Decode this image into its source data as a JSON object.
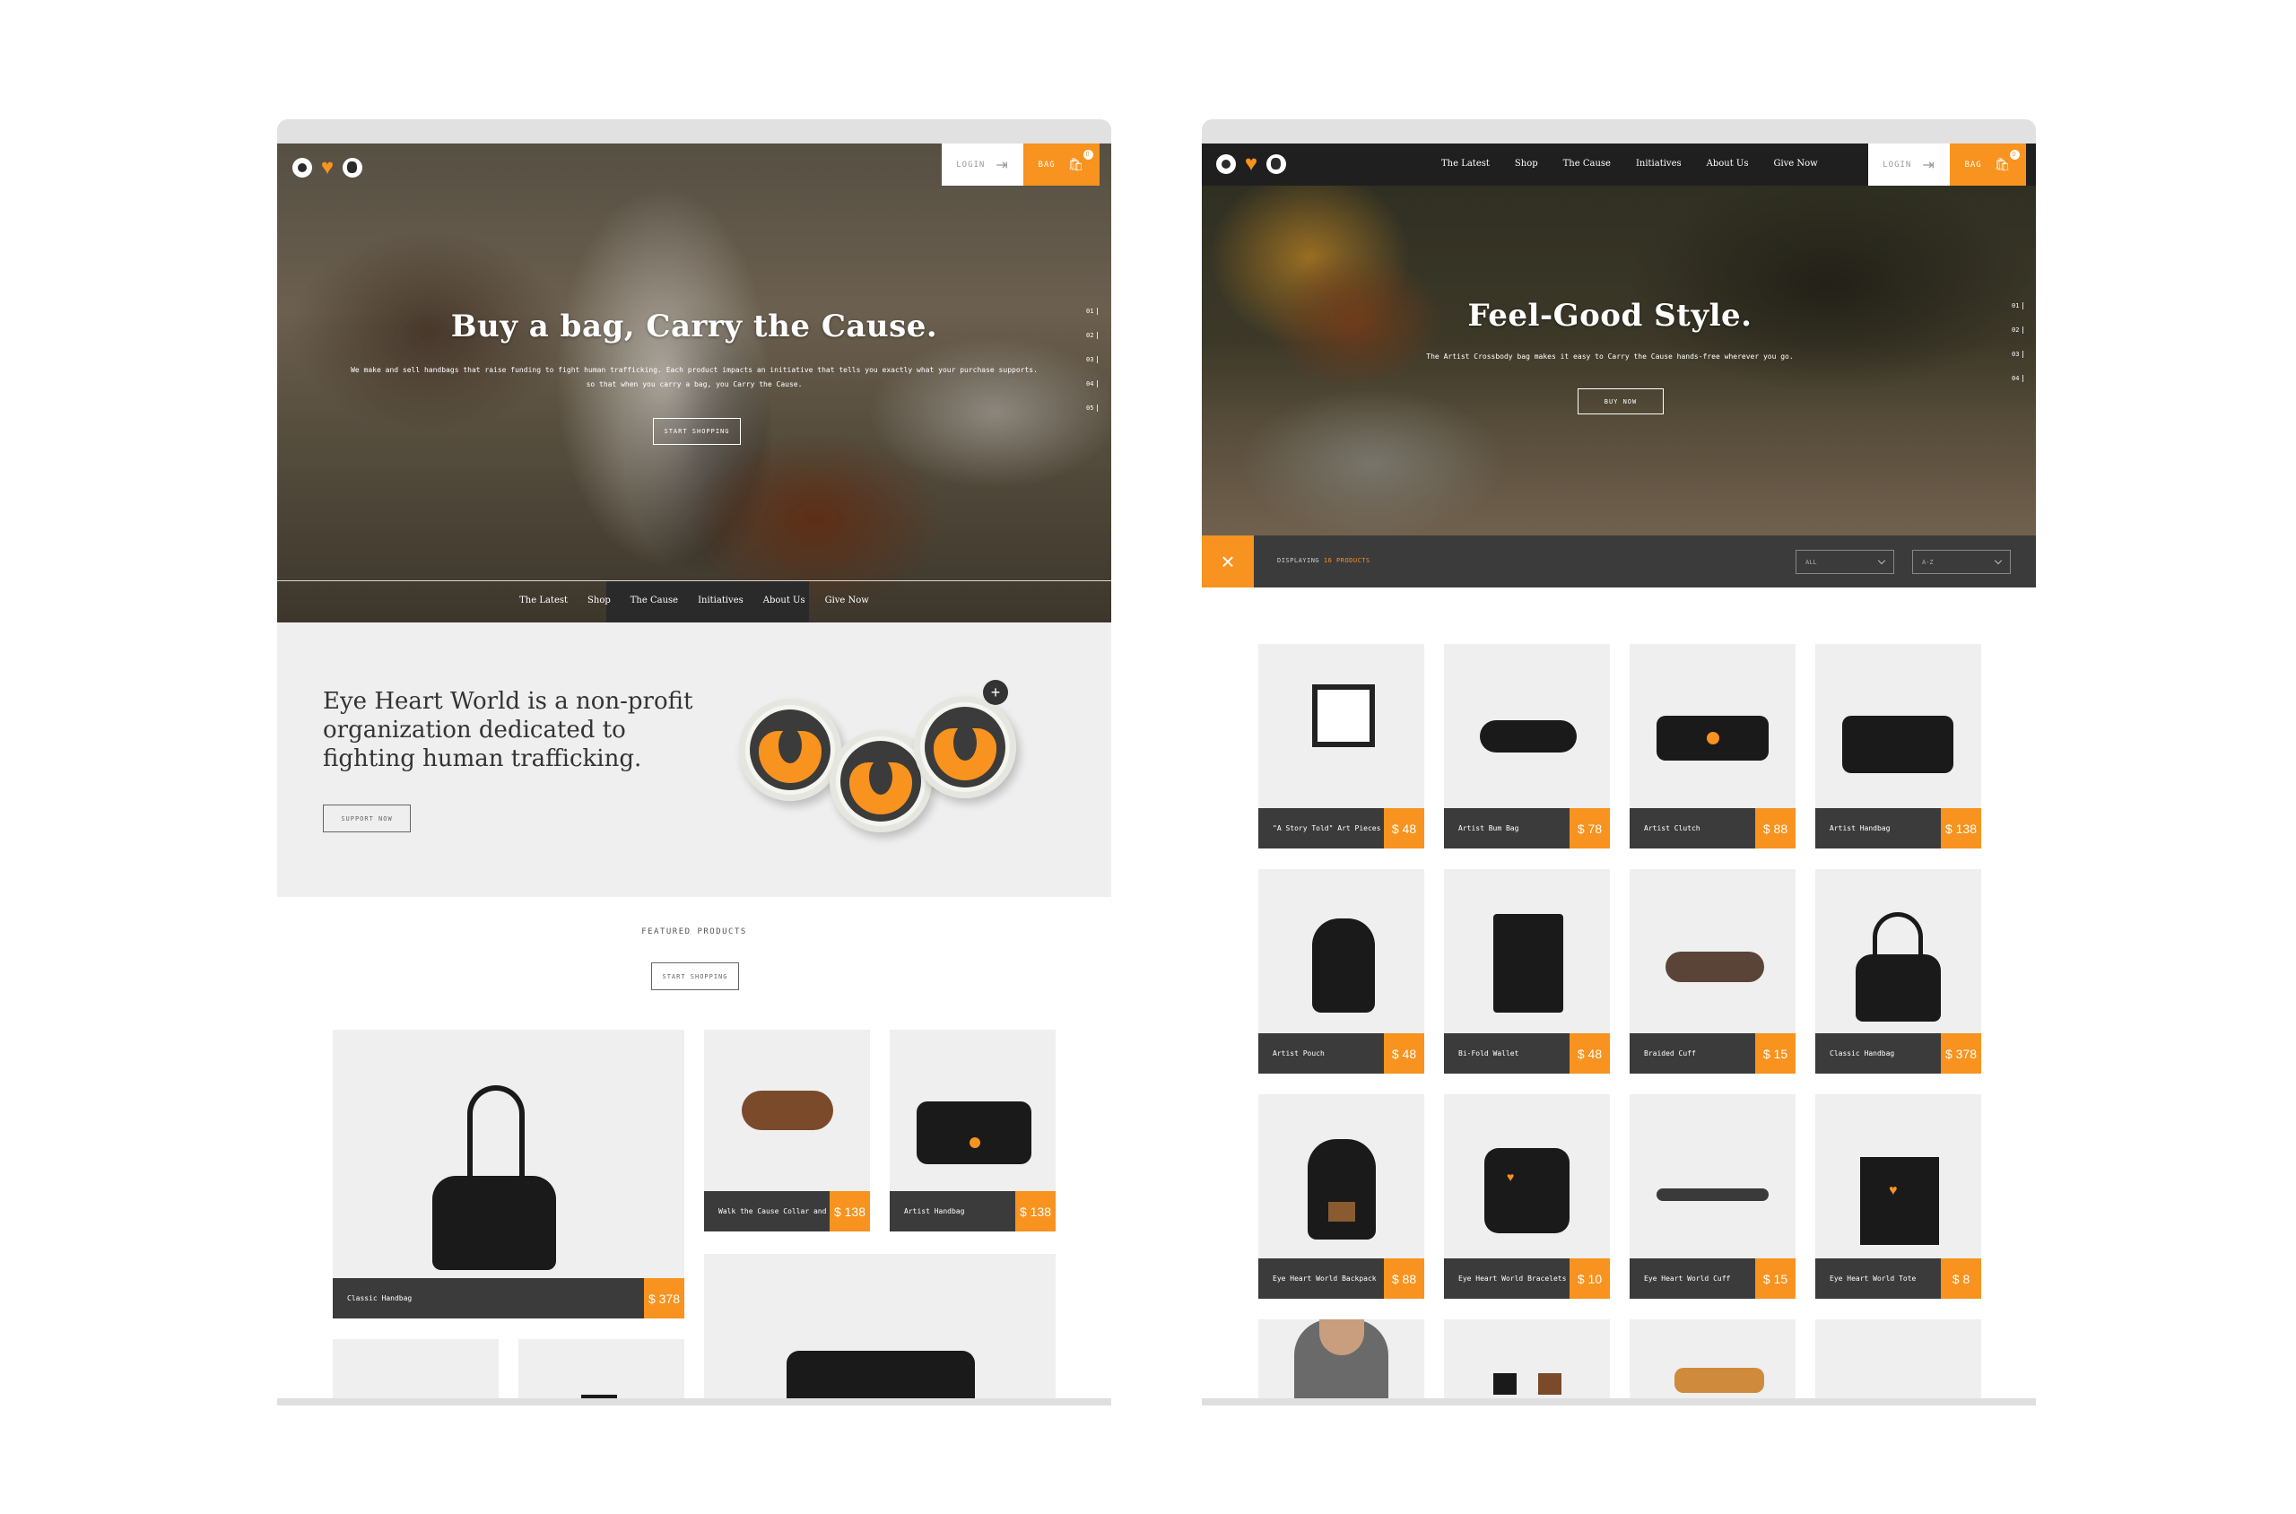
{
  "left": {
    "hero": {
      "title": "Buy a bag, Carry the Cause.",
      "subtitle_line1": "We make and sell handbags that raise funding to fight human trafficking. Each product impacts an initiative that tells you exactly what your purchase supports.",
      "subtitle_line2": "so that when you carry a bag, you Carry the Cause.",
      "button": "START SHOPPING",
      "slides": [
        "01",
        "02",
        "03",
        "04",
        "05"
      ]
    },
    "header": {
      "login": "LOGIN",
      "bag": "BAG",
      "bag_count": "0"
    },
    "nav": [
      "The Latest",
      "Shop",
      "The Cause",
      "Initiatives",
      "About Us",
      "Give Now"
    ],
    "mission": {
      "title": "Eye Heart World is a non-profit organization dedicated to fighting human trafficking.",
      "button": "SUPPORT NOW",
      "plus": "+"
    },
    "featured": {
      "title": "FEATURED PRODUCTS",
      "button": "START SHOPPING",
      "products": [
        {
          "name": "Classic Handbag",
          "price": "$ 378"
        },
        {
          "name": "Walk the Cause Collar and Leash",
          "price": "$ 138"
        },
        {
          "name": "Artist Handbag",
          "price": "$ 138"
        }
      ]
    }
  },
  "right": {
    "nav": [
      "The Latest",
      "Shop",
      "The Cause",
      "Initiatives",
      "About Us",
      "Give Now"
    ],
    "header": {
      "login": "LOGIN",
      "bag": "BAG",
      "bag_count": "0"
    },
    "hero": {
      "title": "Feel-Good Style.",
      "subtitle": "The Artist Crossbody bag makes it easy to Carry the Cause hands-free wherever you go.",
      "button": "BUY NOW",
      "slides": [
        "01",
        "02",
        "03",
        "04"
      ]
    },
    "filter": {
      "displaying": "DISPLAYING",
      "count": "16 PRODUCTS",
      "select1": "ALL",
      "select2": "A-Z",
      "close": "×"
    },
    "products": [
      {
        "name": "\"A Story Told\" Art Pieces",
        "price": "$ 48"
      },
      {
        "name": "Artist Bum Bag",
        "price": "$ 78"
      },
      {
        "name": "Artist Clutch",
        "price": "$ 88"
      },
      {
        "name": "Artist Handbag",
        "price": "$ 138"
      },
      {
        "name": "Artist Pouch",
        "price": "$ 48"
      },
      {
        "name": "Bi-Fold Wallet",
        "price": "$ 48"
      },
      {
        "name": "Braided Cuff",
        "price": "$ 15"
      },
      {
        "name": "Classic Handbag",
        "price": "$ 378"
      },
      {
        "name": "Eye Heart World Backpack",
        "price": "$ 88"
      },
      {
        "name": "Eye Heart World Bracelets",
        "price": "$ 10"
      },
      {
        "name": "Eye Heart World Cuff",
        "price": "$ 15"
      },
      {
        "name": "Eye Heart World Tote",
        "price": "$ 8"
      }
    ]
  },
  "colors": {
    "accent": "#f7931e",
    "dark": "#3b3b3b",
    "light": "#efefef"
  },
  "icons": {
    "logo": [
      "eye-icon",
      "heart-icon",
      "globe-icon"
    ],
    "login": "logout-icon",
    "bag": "cart-icon",
    "close": "close-icon",
    "select": "chevron-down-icon"
  }
}
